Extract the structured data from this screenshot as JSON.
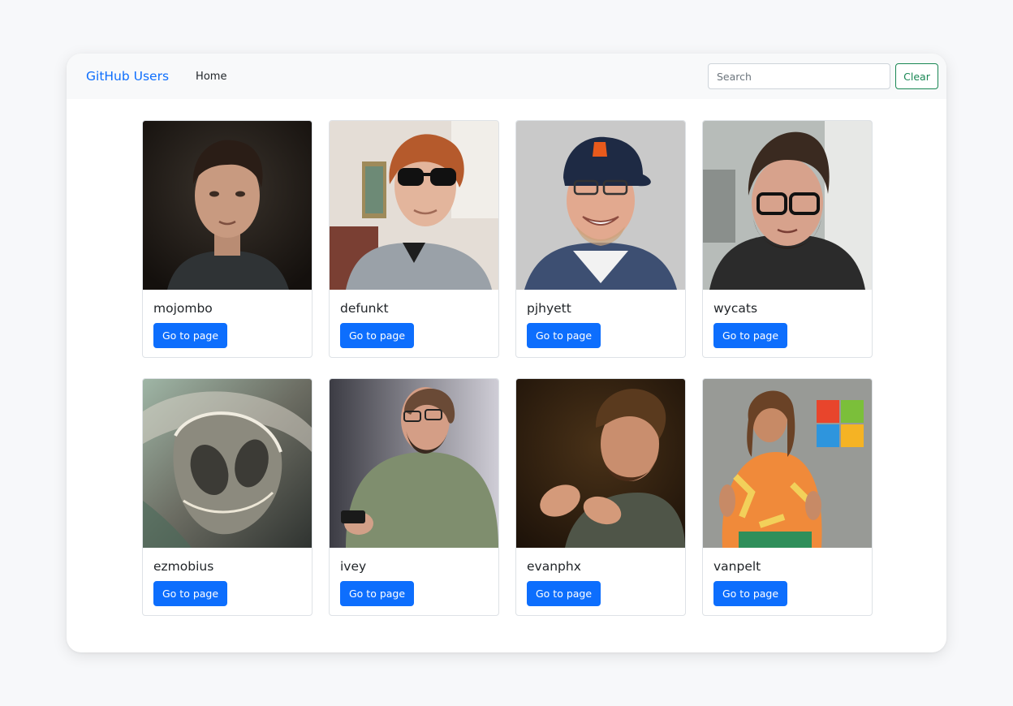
{
  "navbar": {
    "brand": "GitHub Users",
    "home_label": "Home",
    "search_placeholder": "Search",
    "search_value": "",
    "clear_label": "Clear"
  },
  "users": [
    {
      "login": "mojombo",
      "button_label": "Go to page"
    },
    {
      "login": "defunkt",
      "button_label": "Go to page"
    },
    {
      "login": "pjhyett",
      "button_label": "Go to page"
    },
    {
      "login": "wycats",
      "button_label": "Go to page"
    },
    {
      "login": "ezmobius",
      "button_label": "Go to page"
    },
    {
      "login": "ivey",
      "button_label": "Go to page"
    },
    {
      "login": "evanphx",
      "button_label": "Go to page"
    },
    {
      "login": "vanpelt",
      "button_label": "Go to page"
    }
  ],
  "colors": {
    "primary": "#0d6efd",
    "success": "#198754",
    "navbar_bg": "#f8f9fa",
    "page_bg": "#f7f8fa"
  }
}
